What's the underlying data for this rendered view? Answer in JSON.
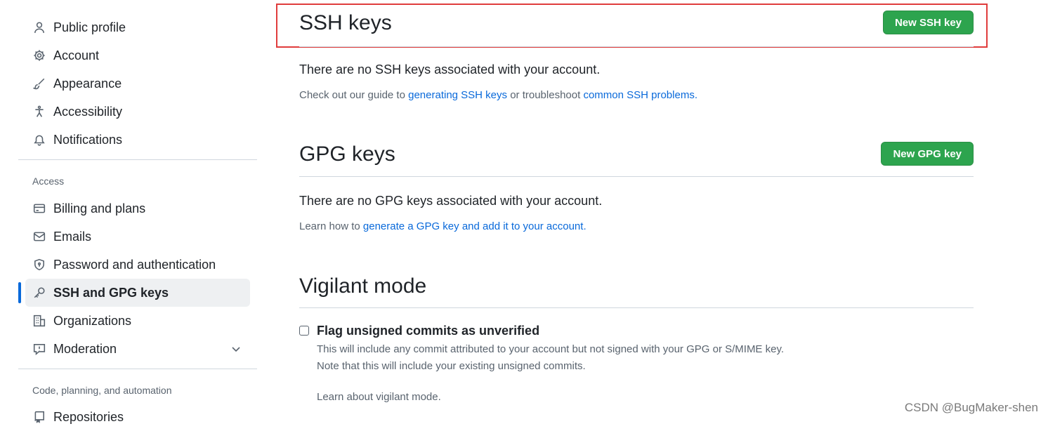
{
  "sidebar": {
    "top_items": [
      {
        "label": "Public profile",
        "icon": "person-icon"
      },
      {
        "label": "Account",
        "icon": "gear-icon"
      },
      {
        "label": "Appearance",
        "icon": "paintbrush-icon"
      },
      {
        "label": "Accessibility",
        "icon": "accessibility-icon"
      },
      {
        "label": "Notifications",
        "icon": "bell-icon"
      }
    ],
    "access_heading": "Access",
    "access_items": [
      {
        "label": "Billing and plans",
        "icon": "credit-card-icon"
      },
      {
        "label": "Emails",
        "icon": "mail-icon"
      },
      {
        "label": "Password and authentication",
        "icon": "shield-icon"
      },
      {
        "label": "SSH and GPG keys",
        "icon": "key-icon",
        "active": true
      },
      {
        "label": "Organizations",
        "icon": "organization-icon"
      },
      {
        "label": "Moderation",
        "icon": "report-icon",
        "expandable": true
      }
    ],
    "code_heading": "Code, planning, and automation",
    "code_items": [
      {
        "label": "Repositories",
        "icon": "repo-icon"
      }
    ]
  },
  "ssh": {
    "title": "SSH keys",
    "button": "New SSH key",
    "empty_text": "There are no SSH keys associated with your account.",
    "guide_prefix": "Check out our guide to ",
    "guide_link1": "generating SSH keys",
    "guide_middle": " or troubleshoot ",
    "guide_link2": "common SSH problems",
    "guide_suffix": "."
  },
  "gpg": {
    "title": "GPG keys",
    "button": "New GPG key",
    "empty_text": "There are no GPG keys associated with your account.",
    "learn_prefix": "Learn how to ",
    "learn_link": "generate a GPG key and add it to your account",
    "learn_suffix": "."
  },
  "vigilant": {
    "title": "Vigilant mode",
    "checkbox_label": "Flag unsigned commits as unverified",
    "checked": false,
    "note1": "This will include any commit attributed to your account but not signed with your GPG or S/MIME key.",
    "note2": "Note that this will include your existing unsigned commits.",
    "learn_link": "Learn about vigilant mode."
  },
  "watermark": "CSDN @BugMaker-shen",
  "colors": {
    "accent": "#0969da",
    "primary_button": "#2da44e",
    "highlight_box": "#e03c3c"
  }
}
